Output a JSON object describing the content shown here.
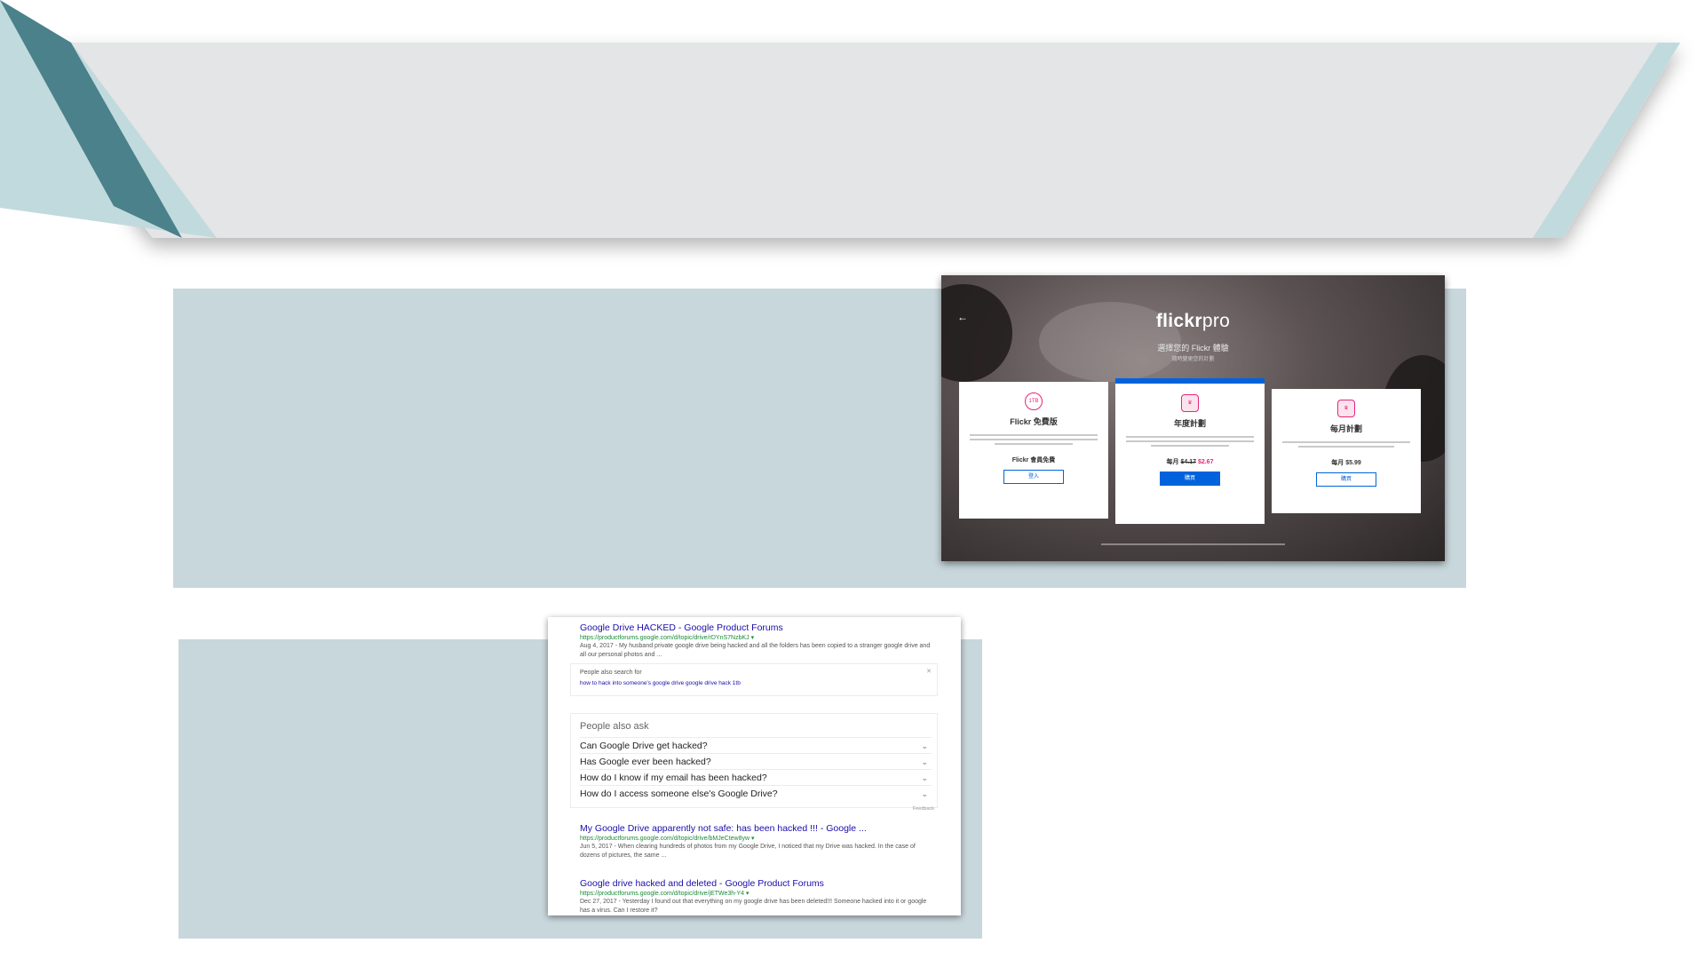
{
  "colors": {
    "banner_fill": "#e4e5e7",
    "banner_light_teal": "#c1dadd",
    "banner_dark_teal": "#4a818a",
    "panel": "#c8d7db"
  },
  "flickr": {
    "back_icon": "arrow-left-icon",
    "logo_bold": "flickr",
    "logo_light": "pro",
    "subtitle": "選擇您的 Flickr 體驗",
    "subtitle2": "隨時變更您的計劃",
    "plans": [
      {
        "name": "Flickr 免費版",
        "badge": "1TB",
        "price": "Flickr 會員免費",
        "button": "登入"
      },
      {
        "name": "年度計劃",
        "badge": "♛",
        "price_prefix": "每月",
        "price_old": "$4.17",
        "price_sale": "$2.67",
        "button": "購買"
      },
      {
        "name": "每月計劃",
        "badge": "♛",
        "price": "每月 $5.99",
        "button": "購買"
      }
    ]
  },
  "google": {
    "result1": {
      "title": "Google Drive HACKED - Google Product Forums",
      "url": "https://productforums.google.com/d/topic/drive/rDYnS7NzbKJ ▾",
      "snippet": "Aug 4, 2017 - My husband private google drive being hacked and all the folders has been copied to a stranger google drive and all our personal photos and ..."
    },
    "also_search": {
      "label": "People also search for",
      "links": "how to hack into someone's google drive     google drive hack 1tb"
    },
    "paa": {
      "heading": "People also ask",
      "questions": [
        "Can Google Drive get hacked?",
        "Has Google ever been hacked?",
        "How do I know if my email has been hacked?",
        "How do I access someone else's Google Drive?"
      ],
      "feedback": "Feedback"
    },
    "result2": {
      "title": "My Google Drive apparently not safe: has been hacked !!! - Google ...",
      "url": "https://productforums.google.com/d/topic/drive/bMJeCtew8yw ▾",
      "snippet": "Jun 5, 2017 - When clearing hundreds of photos from my Google Drive, I noticed that my Drive was hacked. In the case of dozens of pictures, the same ..."
    },
    "result3": {
      "title": "Google drive hacked and deleted - Google Product Forums",
      "url": "https://productforums.google.com/d/topic/drive/jETWe3h-Y4 ▾",
      "snippet": "Dec 27, 2017 - Yesterday I found out that everything on my google drive has been deleted!!! Someone hacked into it or google has a virus. Can I restore it?"
    }
  }
}
